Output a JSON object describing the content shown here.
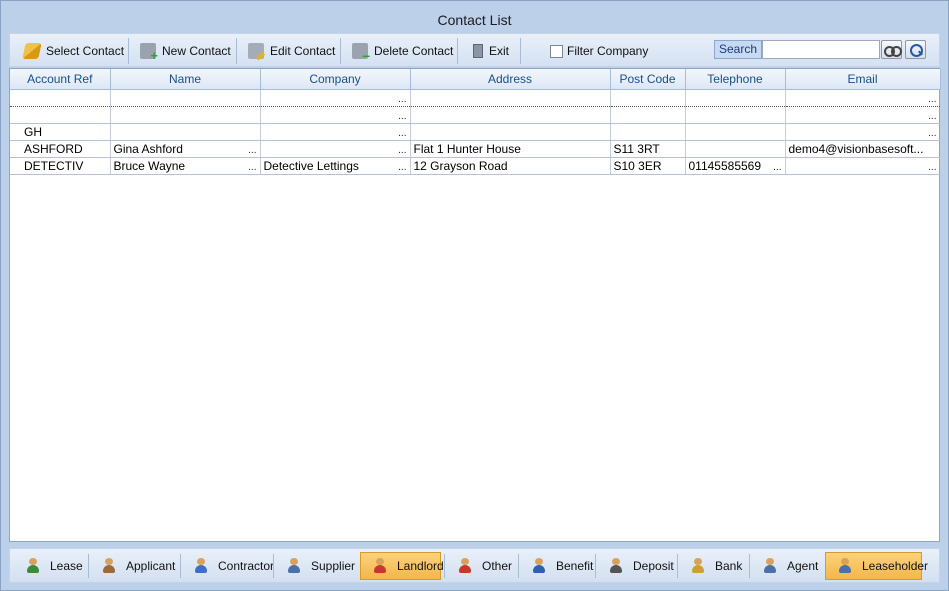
{
  "window": {
    "title": "Contact List"
  },
  "toolbar": {
    "select_label": "Select Contact",
    "new_label": "New Contact",
    "edit_label": "Edit Contact",
    "delete_label": "Delete Contact",
    "exit_label": "Exit",
    "filter_label": "Filter Company",
    "filter_checked": false,
    "search_label": "Search",
    "search_value": ""
  },
  "grid": {
    "columns": [
      "Account Ref",
      "Name",
      "Company",
      "Address",
      "Post Code",
      "Telephone",
      "Email"
    ],
    "rows": [
      {
        "account_ref": "",
        "name": "",
        "company": "",
        "address": "",
        "post_code": "",
        "telephone": "",
        "email": ""
      },
      {
        "account_ref": "",
        "name": "",
        "company": "",
        "address": "",
        "post_code": "",
        "telephone": "",
        "email": ""
      },
      {
        "account_ref": "GH",
        "name": "",
        "company": "",
        "address": "",
        "post_code": "",
        "telephone": "",
        "email": ""
      },
      {
        "account_ref": "ASHFORD",
        "name": "Gina Ashford",
        "company": "",
        "address": "Flat 1 Hunter House",
        "post_code": "S11 3RT",
        "telephone": "",
        "email": "demo4@visionbasesoft..."
      },
      {
        "account_ref": "DETECTIV",
        "name": "Bruce Wayne",
        "company": "Detective Lettings",
        "address": "12 Grayson Road",
        "post_code": "S10 3ER",
        "telephone": "01145585569",
        "email": ""
      }
    ],
    "ellipsis": "..."
  },
  "tabs": [
    {
      "label": "Lease",
      "icon": "lease-icon",
      "active": false
    },
    {
      "label": "Applicant",
      "icon": "applicant-icon",
      "active": false
    },
    {
      "label": "Contractor",
      "icon": "contractor-icon",
      "active": false
    },
    {
      "label": "Supplier",
      "icon": "supplier-icon",
      "active": false
    },
    {
      "label": "Landlord",
      "icon": "landlord-icon",
      "active": true
    },
    {
      "label": "Other",
      "icon": "other-icon",
      "active": false
    },
    {
      "label": "Benefit",
      "icon": "benefit-icon",
      "active": false
    },
    {
      "label": "Deposit",
      "icon": "deposit-icon",
      "active": false
    },
    {
      "label": "Bank",
      "icon": "bank-icon",
      "active": false
    },
    {
      "label": "Agent",
      "icon": "agent-icon",
      "active": false
    },
    {
      "label": "Leaseholder",
      "icon": "leaseholder-icon",
      "active": true
    }
  ],
  "colors": {
    "window_bg": "#bcd0ea",
    "header_text": "#1b4d8c",
    "active_tab": "#f4b64a"
  }
}
